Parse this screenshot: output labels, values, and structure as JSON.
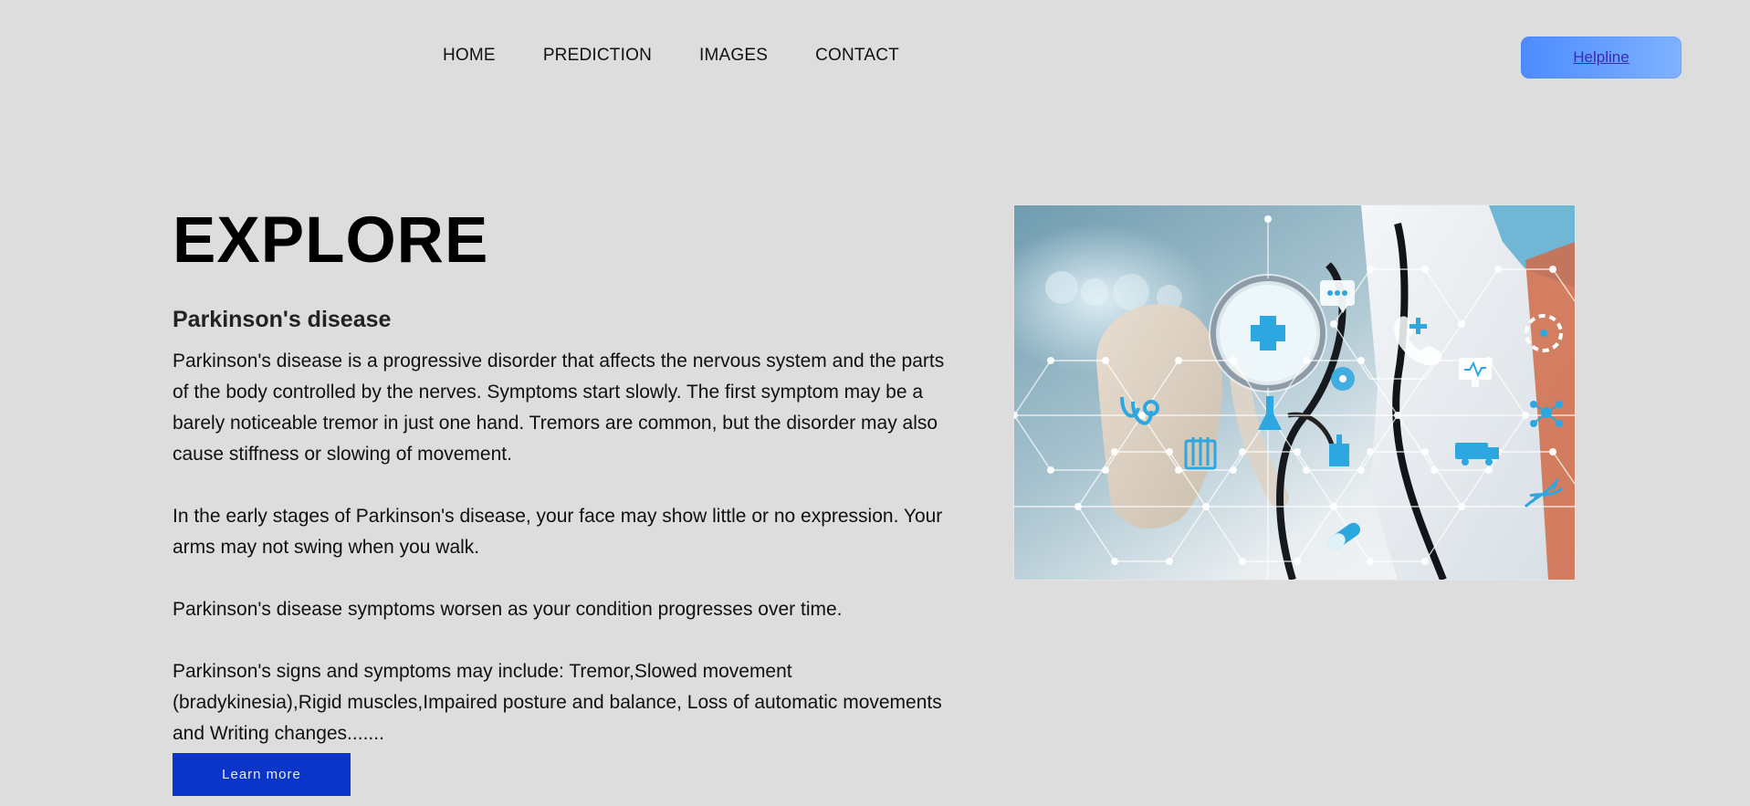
{
  "nav": {
    "items": [
      {
        "label": "HOME"
      },
      {
        "label": "PREDICTION"
      },
      {
        "label": "IMAGES"
      },
      {
        "label": "CONTACT"
      }
    ]
  },
  "header": {
    "helpline_label": "Helpline"
  },
  "hero": {
    "title": "EXPLORE",
    "subtitle": "Parkinson's disease",
    "paragraphs": [
      "Parkinson's disease is a progressive disorder that affects the nervous system and the parts of the body controlled by the nerves. Symptoms start slowly. The first symptom may be a barely noticeable tremor in just one hand. Tremors are common, but the disorder may also cause stiffness or slowing of movement.",
      "In the early stages of Parkinson's disease, your face may show little or no expression. Your arms may not swing when you walk.",
      "Parkinson's disease symptoms worsen as your condition progresses over time.",
      "Parkinson's signs and symptoms may include: Tremor,Slowed movement (bradykinesia),Rigid muscles,Impaired posture and balance, Loss of automatic movements and Writing changes......."
    ],
    "cta_label": "Learn more"
  },
  "image": {
    "icons": [
      "plus-icon",
      "chat-icon",
      "phone-icon",
      "monitor-icon",
      "stethoscope-icon",
      "flask-icon",
      "test-tubes-icon",
      "ambulance-icon",
      "pill-icon",
      "dna-icon",
      "molecule-icon"
    ]
  },
  "colors": {
    "page_background": "#dddddd",
    "helpline_button": "#5b98ff",
    "cta_button": "#0b35c9",
    "accent_icons": "#2ca7df"
  }
}
